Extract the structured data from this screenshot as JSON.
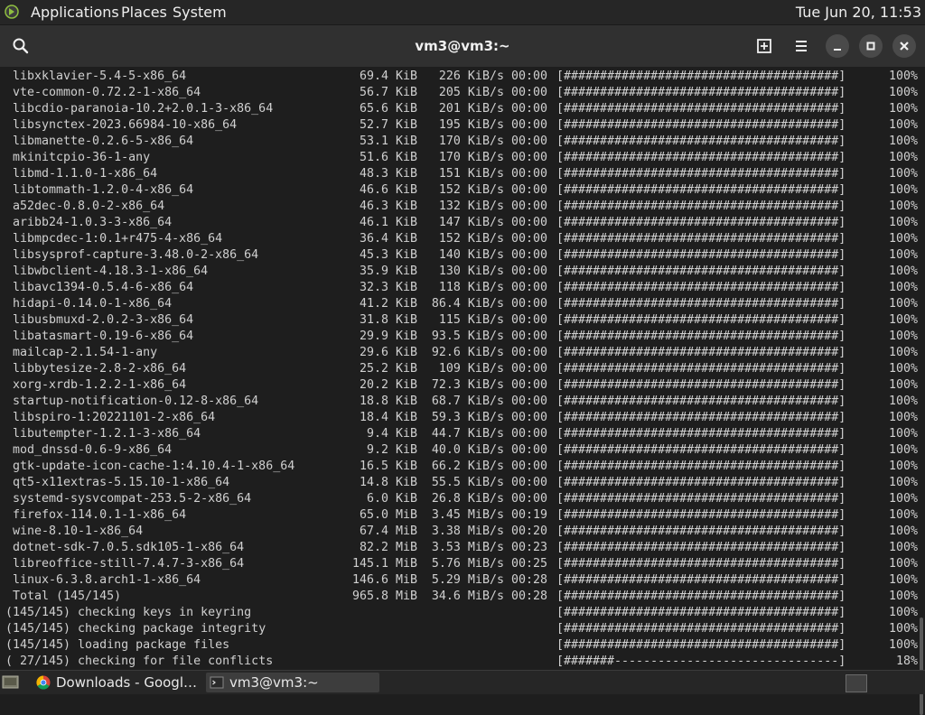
{
  "top_panel": {
    "menus": [
      "Applications",
      "Places",
      "System"
    ],
    "clock": "Tue Jun 20, 11:53"
  },
  "headerbar": {
    "title": "vm3@vm3:~"
  },
  "terminal": {
    "packages": [
      {
        "name": "libxklavier-5.4-5-x86_64",
        "size": "69.4 KiB",
        "rate": "226 KiB/s 00:00",
        "bar": "[######################################]",
        "pct": "100%"
      },
      {
        "name": "vte-common-0.72.2-1-x86_64",
        "size": "56.7 KiB",
        "rate": "205 KiB/s 00:00",
        "bar": "[######################################]",
        "pct": "100%"
      },
      {
        "name": "libcdio-paranoia-10.2+2.0.1-3-x86_64",
        "size": "65.6 KiB",
        "rate": "201 KiB/s 00:00",
        "bar": "[######################################]",
        "pct": "100%"
      },
      {
        "name": "libsynctex-2023.66984-10-x86_64",
        "size": "52.7 KiB",
        "rate": "195 KiB/s 00:00",
        "bar": "[######################################]",
        "pct": "100%"
      },
      {
        "name": "libmanette-0.2.6-5-x86_64",
        "size": "53.1 KiB",
        "rate": "170 KiB/s 00:00",
        "bar": "[######################################]",
        "pct": "100%"
      },
      {
        "name": "mkinitcpio-36-1-any",
        "size": "51.6 KiB",
        "rate": "170 KiB/s 00:00",
        "bar": "[######################################]",
        "pct": "100%"
      },
      {
        "name": "libmd-1.1.0-1-x86_64",
        "size": "48.3 KiB",
        "rate": "151 KiB/s 00:00",
        "bar": "[######################################]",
        "pct": "100%"
      },
      {
        "name": "libtommath-1.2.0-4-x86_64",
        "size": "46.6 KiB",
        "rate": "152 KiB/s 00:00",
        "bar": "[######################################]",
        "pct": "100%"
      },
      {
        "name": "a52dec-0.8.0-2-x86_64",
        "size": "46.3 KiB",
        "rate": "132 KiB/s 00:00",
        "bar": "[######################################]",
        "pct": "100%"
      },
      {
        "name": "aribb24-1.0.3-3-x86_64",
        "size": "46.1 KiB",
        "rate": "147 KiB/s 00:00",
        "bar": "[######################################]",
        "pct": "100%"
      },
      {
        "name": "libmpcdec-1:0.1+r475-4-x86_64",
        "size": "36.4 KiB",
        "rate": "152 KiB/s 00:00",
        "bar": "[######################################]",
        "pct": "100%"
      },
      {
        "name": "libsysprof-capture-3.48.0-2-x86_64",
        "size": "45.3 KiB",
        "rate": "140 KiB/s 00:00",
        "bar": "[######################################]",
        "pct": "100%"
      },
      {
        "name": "libwbclient-4.18.3-1-x86_64",
        "size": "35.9 KiB",
        "rate": "130 KiB/s 00:00",
        "bar": "[######################################]",
        "pct": "100%"
      },
      {
        "name": "libavc1394-0.5.4-6-x86_64",
        "size": "32.3 KiB",
        "rate": "118 KiB/s 00:00",
        "bar": "[######################################]",
        "pct": "100%"
      },
      {
        "name": "hidapi-0.14.0-1-x86_64",
        "size": "41.2 KiB",
        "rate": "86.4 KiB/s 00:00",
        "bar": "[######################################]",
        "pct": "100%"
      },
      {
        "name": "libusbmuxd-2.0.2-3-x86_64",
        "size": "31.8 KiB",
        "rate": "115 KiB/s 00:00",
        "bar": "[######################################]",
        "pct": "100%"
      },
      {
        "name": "libatasmart-0.19-6-x86_64",
        "size": "29.9 KiB",
        "rate": "93.5 KiB/s 00:00",
        "bar": "[######################################]",
        "pct": "100%"
      },
      {
        "name": "mailcap-2.1.54-1-any",
        "size": "29.6 KiB",
        "rate": "92.6 KiB/s 00:00",
        "bar": "[######################################]",
        "pct": "100%"
      },
      {
        "name": "libbytesize-2.8-2-x86_64",
        "size": "25.2 KiB",
        "rate": "109 KiB/s 00:00",
        "bar": "[######################################]",
        "pct": "100%"
      },
      {
        "name": "xorg-xrdb-1.2.2-1-x86_64",
        "size": "20.2 KiB",
        "rate": "72.3 KiB/s 00:00",
        "bar": "[######################################]",
        "pct": "100%"
      },
      {
        "name": "startup-notification-0.12-8-x86_64",
        "size": "18.8 KiB",
        "rate": "68.7 KiB/s 00:00",
        "bar": "[######################################]",
        "pct": "100%"
      },
      {
        "name": "libspiro-1:20221101-2-x86_64",
        "size": "18.4 KiB",
        "rate": "59.3 KiB/s 00:00",
        "bar": "[######################################]",
        "pct": "100%"
      },
      {
        "name": "libutempter-1.2.1-3-x86_64",
        "size": "9.4 KiB",
        "rate": "44.7 KiB/s 00:00",
        "bar": "[######################################]",
        "pct": "100%"
      },
      {
        "name": "mod_dnssd-0.6-9-x86_64",
        "size": "9.2 KiB",
        "rate": "40.0 KiB/s 00:00",
        "bar": "[######################################]",
        "pct": "100%"
      },
      {
        "name": "gtk-update-icon-cache-1:4.10.4-1-x86_64",
        "size": "16.5 KiB",
        "rate": "66.2 KiB/s 00:00",
        "bar": "[######################################]",
        "pct": "100%"
      },
      {
        "name": "qt5-x11extras-5.15.10-1-x86_64",
        "size": "14.8 KiB",
        "rate": "55.5 KiB/s 00:00",
        "bar": "[######################################]",
        "pct": "100%"
      },
      {
        "name": "systemd-sysvcompat-253.5-2-x86_64",
        "size": "6.0 KiB",
        "rate": "26.8 KiB/s 00:00",
        "bar": "[######################################]",
        "pct": "100%"
      },
      {
        "name": "firefox-114.0.1-1-x86_64",
        "size": "65.0 MiB",
        "rate": "3.45 MiB/s 00:19",
        "bar": "[######################################]",
        "pct": "100%"
      },
      {
        "name": "wine-8.10-1-x86_64",
        "size": "67.4 MiB",
        "rate": "3.38 MiB/s 00:20",
        "bar": "[######################################]",
        "pct": "100%"
      },
      {
        "name": "dotnet-sdk-7.0.5.sdk105-1-x86_64",
        "size": "82.2 MiB",
        "rate": "3.53 MiB/s 00:23",
        "bar": "[######################################]",
        "pct": "100%"
      },
      {
        "name": "libreoffice-still-7.4.7-3-x86_64",
        "size": "145.1 MiB",
        "rate": "5.76 MiB/s 00:25",
        "bar": "[######################################]",
        "pct": "100%"
      },
      {
        "name": "linux-6.3.8.arch1-1-x86_64",
        "size": "146.6 MiB",
        "rate": "5.29 MiB/s 00:28",
        "bar": "[######################################]",
        "pct": "100%"
      },
      {
        "name": "Total (145/145)",
        "size": "965.8 MiB",
        "rate": "34.6 MiB/s 00:28",
        "bar": "[######################################]",
        "pct": "100%"
      }
    ],
    "steps": [
      {
        "msg": "(145/145) checking keys in keyring",
        "bar": "[######################################]",
        "pct": "100%"
      },
      {
        "msg": "(145/145) checking package integrity",
        "bar": "[######################################]",
        "pct": "100%"
      },
      {
        "msg": "(145/145) loading package files",
        "bar": "[######################################]",
        "pct": "100%"
      },
      {
        "msg": "( 27/145) checking for file conflicts",
        "bar": "[#######-------------------------------]",
        "pct": "18%"
      }
    ]
  },
  "taskbar": {
    "tasks": [
      {
        "label": "Downloads - Googl…",
        "icon": "chrome-icon"
      },
      {
        "label": "vm3@vm3:~",
        "icon": "terminal-icon"
      }
    ]
  },
  "colors": {
    "panel_bg": "#262626",
    "header_bg": "#303030",
    "terminal_bg": "#1e1e1e",
    "terminal_fg": "#d0d0d0"
  }
}
